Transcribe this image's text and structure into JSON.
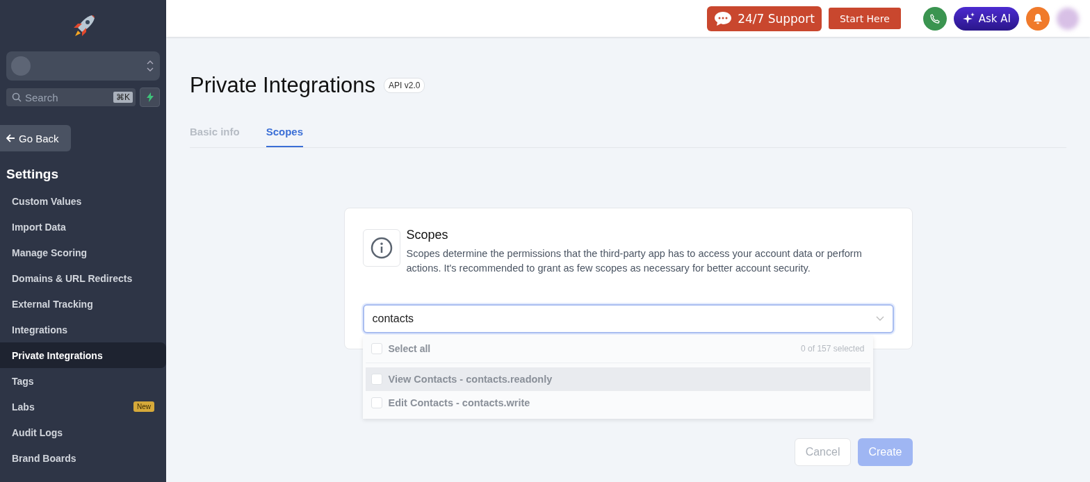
{
  "sidebar": {
    "search": {
      "placeholder": "Search",
      "shortcut": "⌘K"
    },
    "back_button": "Go Back",
    "section_title": "Settings",
    "items": [
      {
        "label": "Custom Values",
        "selected": false
      },
      {
        "label": "Import Data",
        "selected": false
      },
      {
        "label": "Manage Scoring",
        "selected": false
      },
      {
        "label": "Domains & URL Redirects",
        "selected": false
      },
      {
        "label": "External Tracking",
        "selected": false
      },
      {
        "label": "Integrations",
        "selected": false
      },
      {
        "label": "Private Integrations",
        "selected": true
      },
      {
        "label": "Tags",
        "selected": false
      },
      {
        "label": "Labs",
        "selected": false,
        "badge": "New"
      },
      {
        "label": "Audit Logs",
        "selected": false
      },
      {
        "label": "Brand Boards",
        "selected": false
      }
    ]
  },
  "top_bar": {
    "support": "24/7 Support",
    "start": "Start Here",
    "ask_ai": "Ask AI"
  },
  "page": {
    "title": "Private Integrations",
    "api_badge": "API v2.0",
    "tabs": [
      {
        "label": "Basic info",
        "selected": false
      },
      {
        "label": "Scopes",
        "selected": true
      }
    ]
  },
  "card": {
    "title": "Scopes",
    "description": "Scopes determine the permissions that the third-party app has to access your account data or perform actions. It's recommended to grant as few scopes as necessary for better account security.",
    "scope_field": {
      "value": "contacts"
    },
    "dropdown": {
      "select_all": {
        "label": "Select all",
        "checked": false
      },
      "count": "0 of 157 selected",
      "options": [
        {
          "label": "View Contacts - contacts.readonly",
          "checked": false,
          "highlighted": true
        },
        {
          "label": "Edit Contacts - contacts.write",
          "checked": false,
          "highlighted": false
        }
      ]
    }
  },
  "buttons": {
    "cancel": "Cancel",
    "create": "Create"
  }
}
